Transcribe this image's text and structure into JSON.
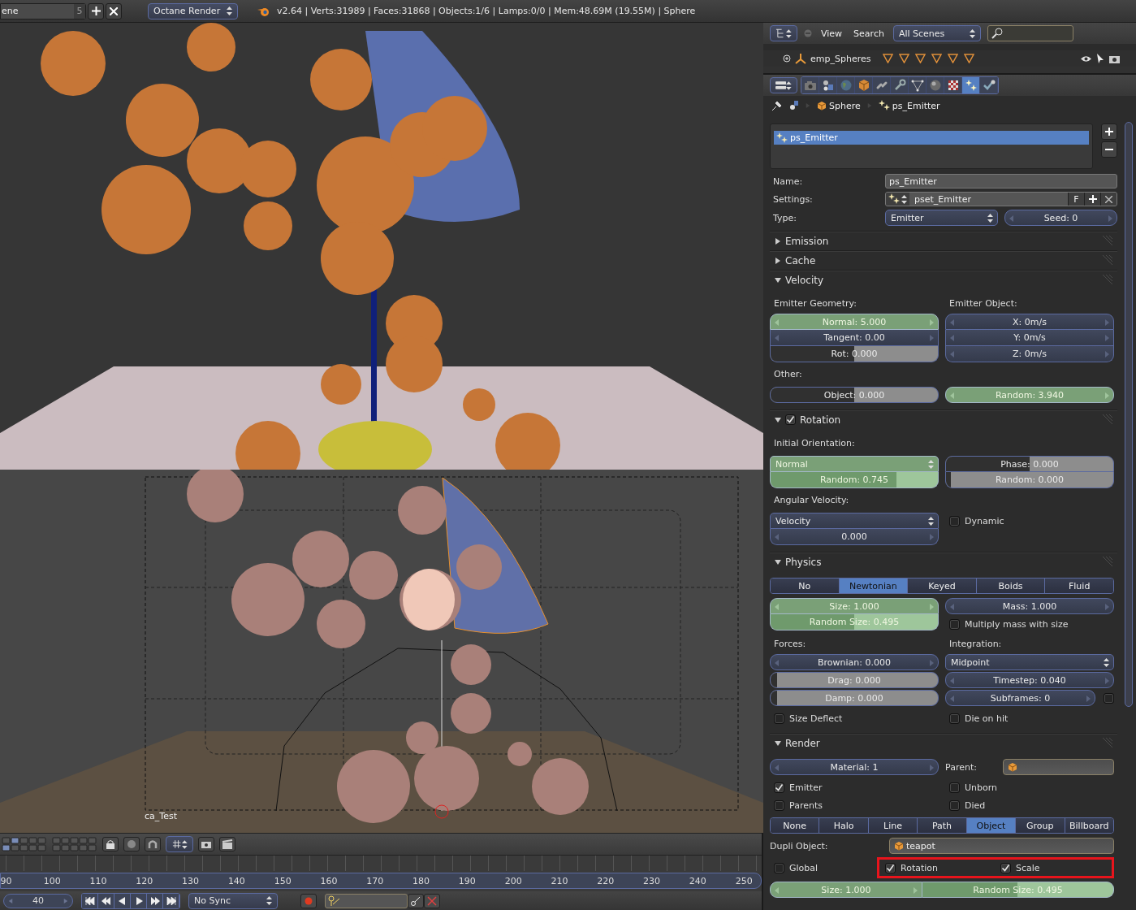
{
  "top_bar": {
    "scene": "ene",
    "scene_count": "5",
    "engine": "Octane Render",
    "stats": "v2.64 | Verts:31989 | Faces:31868 | Objects:1/6 | Lamps:0/0 | Mem:48.69M (19.55M) | Sphere"
  },
  "viewport": {
    "camera_label": "ca_Test"
  },
  "timeline": {
    "ticks": [
      "90",
      "100",
      "110",
      "120",
      "130",
      "140",
      "150",
      "160",
      "170",
      "180",
      "190",
      "200",
      "210",
      "220",
      "230",
      "240",
      "250"
    ],
    "current_frame": "40",
    "sync": "No Sync"
  },
  "outliner": {
    "menus": [
      "View",
      "Search"
    ],
    "filter": "All Scenes",
    "rows": [
      {
        "name": "emp_Spheres"
      }
    ]
  },
  "properties": {
    "context_tabs": [
      {
        "kind": "camera",
        "selected": false
      },
      {
        "kind": "scene",
        "selected": false
      },
      {
        "kind": "world",
        "selected": false
      },
      {
        "kind": "object",
        "selected": false
      },
      {
        "kind": "link",
        "selected": false
      },
      {
        "kind": "wrench",
        "selected": false
      },
      {
        "kind": "mesh",
        "selected": false
      },
      {
        "kind": "material",
        "selected": false
      },
      {
        "kind": "texture",
        "selected": false
      },
      {
        "kind": "particles",
        "selected": true
      },
      {
        "kind": "physics",
        "selected": false
      }
    ],
    "breadcrumb": [
      "Sphere",
      "ps_Emitter"
    ],
    "particle_list": [
      {
        "name": "ps_Emitter",
        "selected": true
      }
    ],
    "name_label": "Name:",
    "name": "ps_Emitter",
    "settings_label": "Settings:",
    "settings": "pset_Emitter",
    "settings_flag": "F",
    "type_label": "Type:",
    "type": "Emitter",
    "seed": "Seed: 0",
    "sections": [
      {
        "title": "Emission",
        "expanded": false
      },
      {
        "title": "Cache",
        "expanded": false
      },
      {
        "title": "Velocity",
        "expanded": true,
        "rows": [
          {
            "kind": "cols",
            "left": [
              {
                "kind": "label",
                "text": "Emitter Geometry:"
              },
              {
                "kind": "stack",
                "fields": [
                  {
                    "kind": "num",
                    "text": "Normal: 5.000",
                    "keyed": true
                  },
                  {
                    "kind": "num",
                    "text": "Tangent: 0.00",
                    "keyed": false
                  },
                  {
                    "kind": "slider",
                    "text": "Rot: 0.000",
                    "keyed": false,
                    "level": 0.5
                  }
                ]
              }
            ],
            "right": [
              {
                "kind": "label",
                "text": "Emitter Object:"
              },
              {
                "kind": "stack",
                "fields": [
                  {
                    "kind": "num",
                    "text": "X: 0m/s",
                    "keyed": false
                  },
                  {
                    "kind": "num",
                    "text": "Y: 0m/s",
                    "keyed": false
                  },
                  {
                    "kind": "num",
                    "text": "Z: 0m/s",
                    "keyed": false
                  }
                ]
              }
            ]
          },
          {
            "kind": "cols",
            "left": [
              {
                "kind": "label",
                "text": "Other:"
              }
            ]
          },
          {
            "kind": "cols",
            "left": [
              {
                "kind": "stack",
                "fields": [
                  {
                    "kind": "slider",
                    "text": "Object: 0.000",
                    "keyed": false,
                    "level": 0.5
                  }
                ]
              }
            ],
            "right": [
              {
                "kind": "stack",
                "fields": [
                  {
                    "kind": "num",
                    "text": "Random: 3.940",
                    "keyed": true
                  }
                ]
              }
            ]
          }
        ]
      },
      {
        "title": "Rotation",
        "expanded": true,
        "checked": true,
        "rows": [
          {
            "kind": "cols",
            "left": [
              {
                "kind": "label",
                "text": "Initial Orientation:"
              }
            ]
          },
          {
            "kind": "cols",
            "left": [
              {
                "kind": "stack",
                "fields": [
                  {
                    "kind": "enum",
                    "text": "Normal",
                    "keyed": true
                  },
                  {
                    "kind": "slider",
                    "text": "Random: 0.745",
                    "keyed": true,
                    "level": 0.75
                  }
                ]
              }
            ],
            "right": [
              {
                "kind": "stack",
                "fields": [
                  {
                    "kind": "slider",
                    "text": "Phase: 0.000",
                    "keyed": false,
                    "level": 0.5
                  },
                  {
                    "kind": "slider",
                    "text": "Random: 0.000",
                    "keyed": false,
                    "level": 0.03
                  }
                ]
              }
            ]
          },
          {
            "kind": "cols",
            "left": [
              {
                "kind": "label",
                "text": "Angular Velocity:"
              }
            ]
          },
          {
            "kind": "cols",
            "left": [
              {
                "kind": "stack",
                "fields": [
                  {
                    "kind": "enum",
                    "text": "Velocity",
                    "keyed": false
                  },
                  {
                    "kind": "num",
                    "text": "0.000",
                    "keyed": false
                  }
                ]
              }
            ],
            "right": [
              {
                "kind": "check",
                "text": "Dynamic",
                "checked": false
              }
            ]
          }
        ]
      },
      {
        "title": "Physics",
        "expanded": true,
        "rows": [
          {
            "kind": "tabs",
            "options": [
              {
                "label": "No",
                "selected": false
              },
              {
                "label": "Newtonian",
                "selected": true
              },
              {
                "label": "Keyed",
                "selected": false
              },
              {
                "label": "Boids",
                "selected": false
              },
              {
                "label": "Fluid",
                "selected": false
              }
            ]
          },
          {
            "kind": "cols",
            "left": [
              {
                "kind": "stack",
                "fields": [
                  {
                    "kind": "num",
                    "text": "Size: 1.000",
                    "keyed": true
                  },
                  {
                    "kind": "slider",
                    "text": "Random Size: 0.495",
                    "keyed": true,
                    "level": 0.5
                  }
                ]
              }
            ],
            "right": [
              {
                "kind": "stack",
                "fields": [
                  {
                    "kind": "num",
                    "text": "Mass: 1.000",
                    "keyed": false
                  }
                ]
              },
              {
                "kind": "check",
                "text": "Multiply mass with size",
                "checked": false
              }
            ]
          },
          {
            "kind": "cols",
            "left": [
              {
                "kind": "label",
                "text": "Forces:"
              },
              {
                "kind": "stack",
                "fields": [
                  {
                    "kind": "num",
                    "text": "Brownian: 0.000",
                    "keyed": false
                  }
                ]
              },
              {
                "kind": "stack",
                "fields": [
                  {
                    "kind": "slider",
                    "text": "Drag: 0.000",
                    "keyed": false,
                    "level": 0.04
                  }
                ]
              },
              {
                "kind": "stack",
                "fields": [
                  {
                    "kind": "slider",
                    "text": "Damp: 0.000",
                    "keyed": false,
                    "level": 0.04
                  }
                ]
              }
            ],
            "right": [
              {
                "kind": "label",
                "text": "Integration:"
              },
              {
                "kind": "stack",
                "fields": [
                  {
                    "kind": "enum",
                    "text": "Midpoint",
                    "keyed": false
                  }
                ]
              },
              {
                "kind": "stack",
                "fields": [
                  {
                    "kind": "num",
                    "text": "Timestep: 0.040",
                    "keyed": false
                  }
                ]
              },
              {
                "kind": "numcheck",
                "text": "Subframes: 0",
                "checked": false
              }
            ]
          },
          {
            "kind": "cols",
            "left": [
              {
                "kind": "check",
                "text": "Size Deflect",
                "checked": false
              }
            ],
            "right": [
              {
                "kind": "check",
                "text": "Die on hit",
                "checked": false
              }
            ]
          }
        ]
      },
      {
        "title": "Render",
        "expanded": true,
        "rows": [
          {
            "kind": "cols",
            "left": [
              {
                "kind": "stack",
                "fields": [
                  {
                    "kind": "num",
                    "text": "Material: 1",
                    "keyed": false
                  }
                ]
              }
            ],
            "right": [
              {
                "kind": "ref",
                "label": "Parent:"
              }
            ]
          },
          {
            "kind": "cols",
            "left": [
              {
                "kind": "check",
                "text": "Emitter",
                "checked": true
              },
              {
                "kind": "check",
                "text": "Parents",
                "checked": false
              }
            ],
            "right": [
              {
                "kind": "check",
                "text": "Unborn",
                "checked": false
              },
              {
                "kind": "check",
                "text": "Died",
                "checked": false
              }
            ]
          },
          {
            "kind": "tabs",
            "options": [
              {
                "label": "None",
                "selected": false
              },
              {
                "label": "Halo",
                "selected": false
              },
              {
                "label": "Line",
                "selected": false
              },
              {
                "label": "Path",
                "selected": false
              },
              {
                "label": "Object",
                "selected": true
              },
              {
                "label": "Group",
                "selected": false
              },
              {
                "label": "Billboard",
                "selected": false
              }
            ]
          },
          {
            "kind": "ref",
            "label": "Dupli Object:",
            "value": "teapot"
          },
          {
            "kind": "checks",
            "items": [
              {
                "label": "Global",
                "checked": false,
                "highlighted": false
              },
              {
                "label": "Rotation",
                "checked": true,
                "highlighted": true
              },
              {
                "label": "Scale",
                "checked": true,
                "highlighted": true
              }
            ]
          },
          {
            "kind": "hstack",
            "fields": [
              {
                "kind": "num",
                "text": "Size: 1.000",
                "keyed": true
              },
              {
                "kind": "slider",
                "text": "Random Size: 0.495",
                "keyed": true,
                "level": 0.5
              }
            ]
          }
        ]
      }
    ]
  }
}
